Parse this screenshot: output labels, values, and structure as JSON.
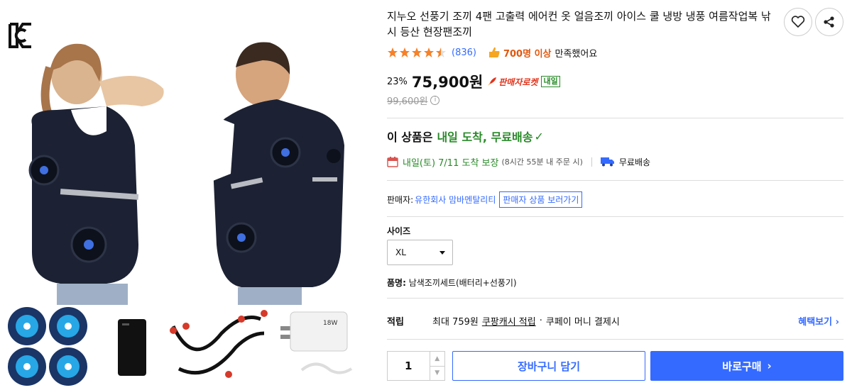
{
  "product": {
    "title": "지누오 선풍기 조끼 4팬 고출력 에어컨 옷 얼음조끼 아이스 쿨 냉방 냉풍 여름작업복 낚시 등산 현장팬조끼",
    "rating": 4.5,
    "review_count": "(836)",
    "satisfaction_strong": "700명 이상",
    "satisfaction_rest": "만족했어요"
  },
  "pricing": {
    "discount": "23%",
    "price": "75,900원",
    "rocket_label": "판매자로켓",
    "naeil_badge": "내일",
    "original_price": "99,600원",
    "info_symbol": "i"
  },
  "delivery": {
    "head_prefix": "이 상품은",
    "head_green": "내일 도착, 무료배송",
    "check_symbol": "✓",
    "arrival_green": "내일(토) 7/11 도착 보장",
    "arrival_note": "(8시간 55분 내 주문 시)",
    "free_shipping": "무료배송"
  },
  "seller": {
    "label": "판매자:",
    "name": "유한회사 맘바멘탈리티",
    "link": "판매자 상품 보러가기"
  },
  "options": {
    "size_label": "사이즈",
    "size_value": "XL",
    "item_label": "품명:",
    "item_value": "남색조끼세트(배터리+선풍기)"
  },
  "points": {
    "label": "적립",
    "max_text": "최대 759원",
    "cash_text": "쿠팡캐시 적립",
    "dot": "·",
    "pay_text": "쿠페이 머니 결제시",
    "benefit_link": "혜택보기 ›"
  },
  "purchase": {
    "quantity": "1",
    "up_symbol": "▲",
    "down_symbol": "▼",
    "cart_label": "장바구니 담기",
    "buy_label": "바로구매",
    "buy_chevron": "›"
  },
  "images": {
    "cert_icon": "kc-mark-icon",
    "charger_text": "18W"
  },
  "colors": {
    "accent": "#346aff",
    "green": "#2a8a2a",
    "orange": "#e0570d",
    "star": "#f5822a",
    "vest": "#1c2233"
  }
}
